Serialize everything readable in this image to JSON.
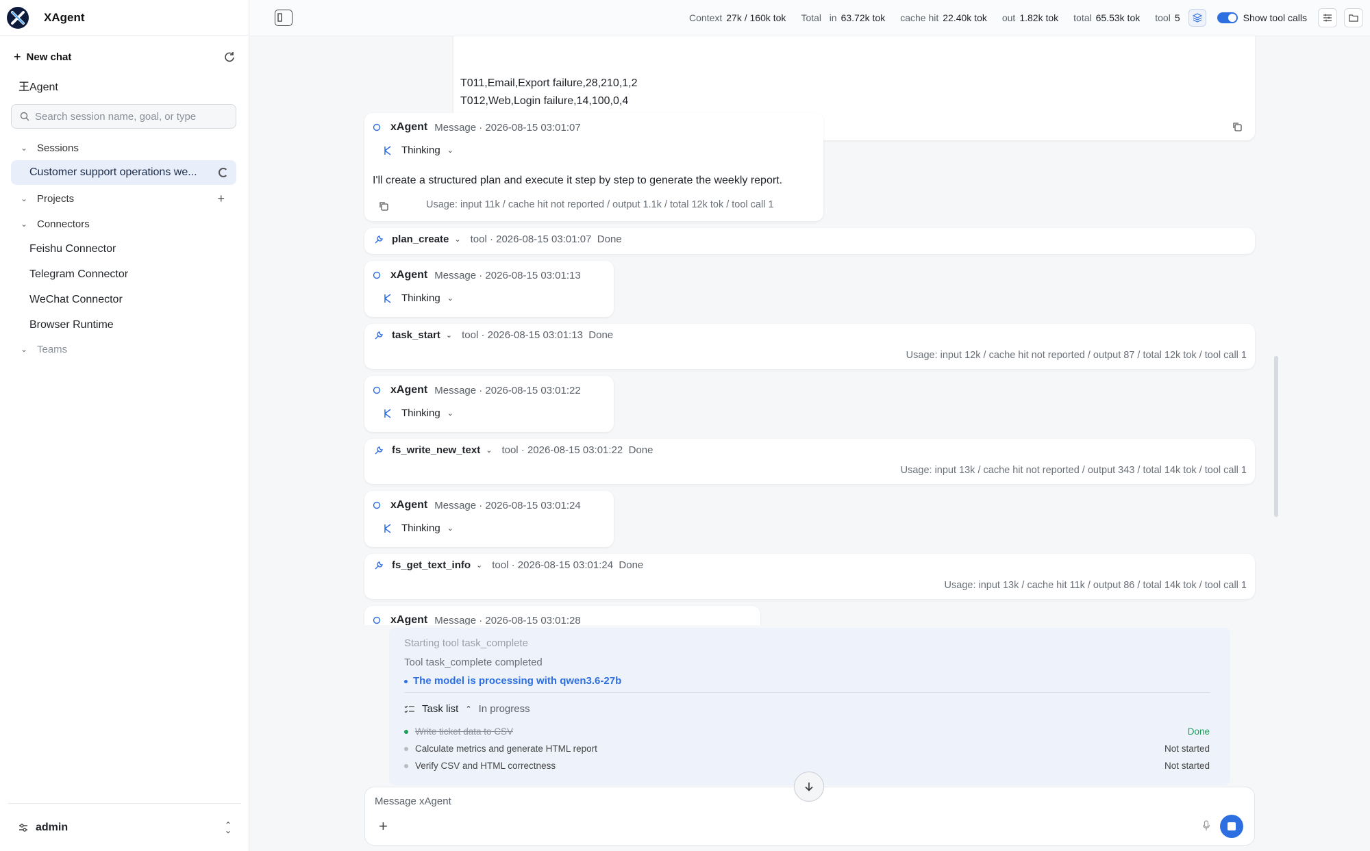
{
  "app": {
    "name": "XAgent"
  },
  "sidebar": {
    "new_chat": "New chat",
    "agent_label": "王Agent",
    "search_placeholder": "Search session name, goal, or type",
    "sections": {
      "sessions": "Sessions",
      "projects": "Projects",
      "connectors": "Connectors",
      "teams": "Teams"
    },
    "active_session": "Customer support operations we...",
    "connectors": [
      "Feishu Connector",
      "Telegram Connector",
      "WeChat Connector",
      "Browser Runtime"
    ],
    "user": "admin"
  },
  "topbar": {
    "context_label": "Context",
    "context_value": "27k / 160k tok",
    "total_label": "Total",
    "in_label": "in",
    "in_value": "63.72k tok",
    "cache_label": "cache hit",
    "cache_value": "22.40k tok",
    "out_label": "out",
    "out_value": "1.82k tok",
    "total2_label": "total",
    "total2_value": "65.53k tok",
    "tool_label": "tool",
    "tool_value": "5",
    "show_tool_calls": "Show tool calls"
  },
  "chat": {
    "csv_lines": [
      "T011,Email,Export failure,28,210,1,2",
      "T012,Web,Login failure,14,100,0,4"
    ],
    "agent_name": "xAgent",
    "thinking_label": "Thinking",
    "messages": [
      {
        "meta": "Message · 2026-08-15 03:01:07",
        "body": "I'll create a structured plan and execute it step by step to generate the weekly report.",
        "usage": "Usage: input 11k / cache hit not reported / output 1.1k / total 12k tok / tool call 1"
      },
      {
        "meta": "Message · 2026-08-15 03:01:13"
      },
      {
        "meta": "Message · 2026-08-15 03:01:22"
      },
      {
        "meta": "Message · 2026-08-15 03:01:24"
      },
      {
        "meta": "Message · 2026-08-15 03:01:28"
      }
    ],
    "tools": [
      {
        "name": "plan_create",
        "meta": "tool · 2026-08-15 03:01:07",
        "status": "Done"
      },
      {
        "name": "task_start",
        "meta": "tool · 2026-08-15 03:01:13",
        "status": "Done",
        "usage": "Usage: input 12k / cache hit not reported / output 87 / total 12k tok / tool call 1"
      },
      {
        "name": "fs_write_new_text",
        "meta": "tool · 2026-08-15 03:01:22",
        "status": "Done",
        "usage": "Usage: input 13k / cache hit not reported / output 343 / total 14k tok / tool call 1"
      },
      {
        "name": "fs_get_text_info",
        "meta": "tool · 2026-08-15 03:01:24",
        "status": "Done",
        "usage": "Usage: input 13k / cache hit 11k / output 86 / total 14k tok / tool call 1"
      }
    ],
    "progress": {
      "starting": "Starting tool task_complete",
      "completed": "Tool task_complete completed",
      "processing": "The model is processing with qwen3.6-27b",
      "task_list_label": "Task list",
      "task_list_status": "In progress",
      "tasks": [
        {
          "label": "Write ticket data to CSV",
          "status": "Done"
        },
        {
          "label": "Calculate metrics and generate HTML report",
          "status": "Not started"
        },
        {
          "label": "Verify CSV and HTML correctness",
          "status": "Not started"
        }
      ]
    },
    "composer_placeholder": "Message xAgent"
  },
  "colors": {
    "accent": "#2d6fe0",
    "done": "#1e9e5a",
    "active_session_bg": "#e8effb"
  }
}
